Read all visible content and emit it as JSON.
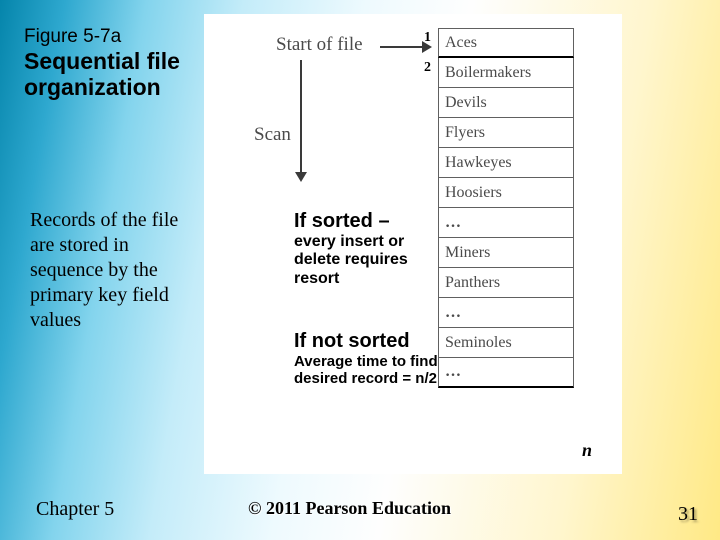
{
  "figure": {
    "label": "Figure 5-7a",
    "title_l1": "Sequential file",
    "title_l2": "organization"
  },
  "records_paragraph": "Records of the file are stored in sequence by the primary key field values",
  "diagram": {
    "start_label": "Start of file",
    "scan_label": "Scan",
    "num1": "1",
    "num2": "2",
    "n_label": "n"
  },
  "file_rows": [
    "Aces",
    "Boilermakers",
    "Devils",
    "Flyers",
    "Hawkeyes",
    "Hoosiers",
    "…",
    "Miners",
    "Panthers",
    "…",
    "Seminoles",
    "…"
  ],
  "sorted": {
    "heading": "If sorted –",
    "body": "every insert or delete requires resort"
  },
  "notsorted": {
    "heading": "If not sorted",
    "body": "Average time to find desired record = n/2"
  },
  "footer": {
    "chapter": "Chapter 5",
    "copyright": "© 2011 Pearson Education",
    "page": "31"
  }
}
